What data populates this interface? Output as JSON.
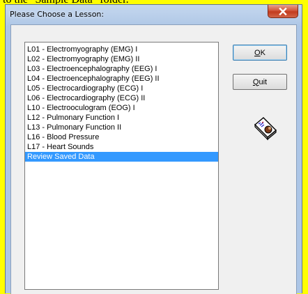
{
  "document": {
    "caption_fragment": "to the \"Sample Data\" folder."
  },
  "window": {
    "title": "Please Choose a Lesson:"
  },
  "lessons": {
    "items": [
      "L01 - Electromyography (EMG) I",
      "L02 - Electromyography (EMG) II",
      "L03 - Electroencephalography (EEG) I",
      "L04 - Electroencephalography (EEG) II",
      "L05 - Electrocardiography (ECG) I",
      "L06 - Electrocardiography (ECG) II",
      "L10 - Electrooculogram (EOG) I",
      "L12 - Pulmonary Function I",
      "L13 - Pulmonary Function II",
      "L16 - Blood Pressure",
      "L17 - Heart Sounds",
      "Review Saved Data"
    ],
    "selected": "Review Saved Data"
  },
  "buttons": {
    "ok_mnemonic": "O",
    "ok_rest": "K",
    "quit_mnemonic": "Q",
    "quit_rest": "uit"
  },
  "icons": {
    "close": "close-icon",
    "lesson": "lesson-book-icon"
  },
  "colors": {
    "page_background": "#ffff00",
    "selection": "#3399ff",
    "close_button": "#c23b1e"
  }
}
